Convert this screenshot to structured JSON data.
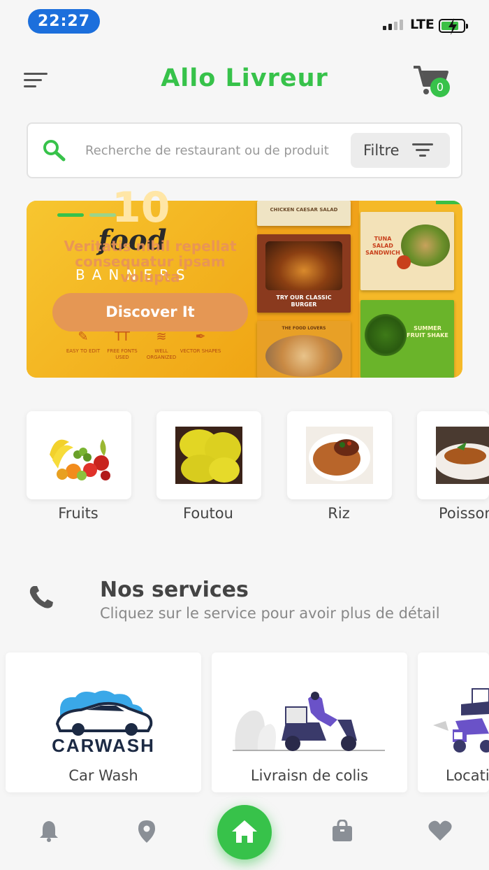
{
  "status_bar": {
    "time": "22:27",
    "network": "LTE"
  },
  "header": {
    "title": "Allo Livreur",
    "cart_count": "0"
  },
  "search": {
    "placeholder": "Recherche de restaurant ou de produit",
    "filter_label": "Filtre"
  },
  "banner": {
    "text": "Veritatis nihil repellat consequatur ipsam volupta",
    "button_label": "Discover It",
    "image_text": {
      "number": "10",
      "food": "food",
      "banners": "BANNERS",
      "features": [
        "EASY TO EDIT",
        "FREE FONTS USED",
        "WELL ORGANIZED",
        "VECTOR SHAPES"
      ],
      "cards": [
        "CHICKEN CAESAR SALAD",
        "TRY OUR CLASSIC BURGER",
        "TUNA SALAD SANDWICH",
        "SUMMER FRUIT SHAKE",
        "THE FOOD LOVERS"
      ]
    }
  },
  "categories": [
    {
      "label": "Fruits"
    },
    {
      "label": "Foutou"
    },
    {
      "label": "Riz"
    },
    {
      "label": "Poisson"
    }
  ],
  "services": {
    "title": "Nos services",
    "subtitle": "Cliquez sur le service pour avoir plus de détail",
    "items": [
      {
        "label": "Car Wash",
        "image_text": "CARWASH"
      },
      {
        "label": "Livraisn de colis"
      },
      {
        "label": "Location"
      }
    ]
  },
  "colors": {
    "accent": "#37c24a",
    "status_pill": "#1c6fdc",
    "banner": "#f4b21c"
  },
  "bottom_nav": [
    "bell-icon",
    "location-pin-icon",
    "home-icon",
    "shopping-bag-icon",
    "heart-icon"
  ]
}
